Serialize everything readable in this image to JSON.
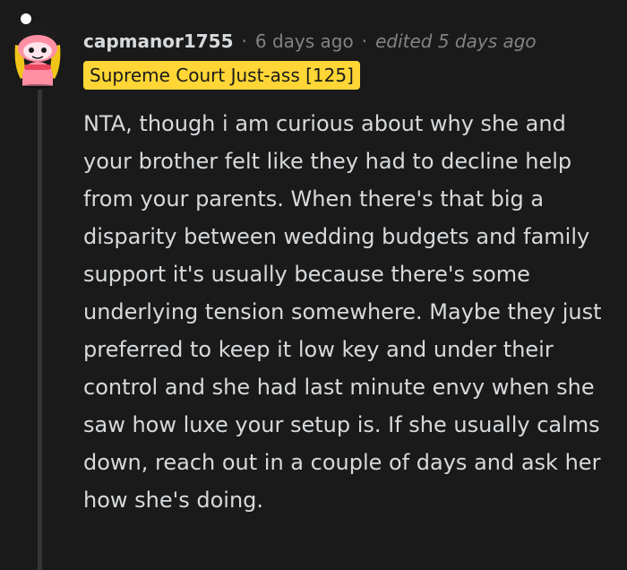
{
  "comment": {
    "username": "capmanor1755",
    "separator": "·",
    "timestamp": "6 days ago",
    "edited": "edited 5 days ago",
    "flair": "Supreme Court Just-ass [125]",
    "body": "NTA, though i am curious about why she and your brother felt like they had to decline help from your parents. When there's that big a disparity between wedding budgets and family support it's usually because there's some underlying tension somewhere. Maybe they just preferred to keep it low key and under their control and she had last minute envy when she saw how luxe your setup is. If she usually calms down, reach out in a couple of days and ask her how she's doing."
  },
  "colors": {
    "background": "#1a1a1b",
    "text": "#d7dadc",
    "meta": "#818384",
    "flair_bg": "#ffd635",
    "thread_line": "#343536"
  },
  "icons": {
    "avatar": "snoo-avatar-icon"
  }
}
